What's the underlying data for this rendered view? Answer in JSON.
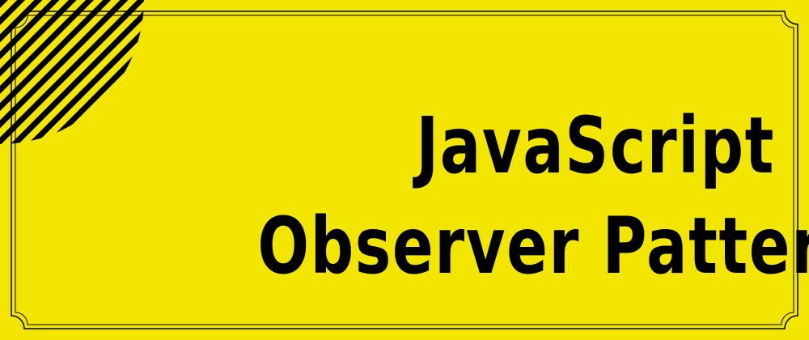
{
  "banner": {
    "title_line_1": "JavaScript",
    "title_line_2": "Observer Pattern"
  },
  "colors": {
    "background": "#f2e600",
    "ink": "#000000"
  },
  "icons": {
    "corner_decoration": "striped-quarter-circle"
  }
}
